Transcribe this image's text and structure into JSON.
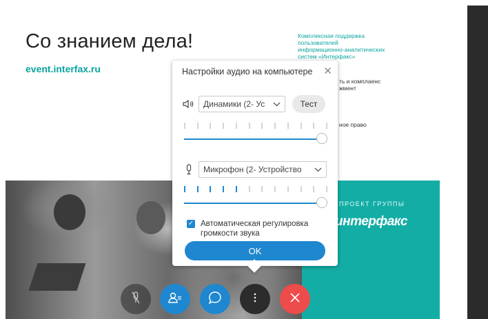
{
  "slide": {
    "title": "Со знанием дела!",
    "url": "event.interfax.ru",
    "info_text": "Комплексная поддержка\nпользователей\nинформационно-аналитических\nсистем «Интерфакс»",
    "bullets": [
      "ть и комплаенс\nжмент",
      "ное право"
    ],
    "teal_caption": "ПРОЕКТ ГРУППЫ",
    "teal_logo": "интерфакс",
    "colors": {
      "teal": "#13ada6",
      "title": "#222222"
    }
  },
  "audio_dialog": {
    "title": "Настройки аудио на компьютере",
    "close_icon": "close-icon",
    "speaker": {
      "icon": "speaker-icon",
      "selected": "Динамики (2- Ус",
      "test_label": "Тест",
      "meter_level": 0,
      "volume": 1.0
    },
    "microphone": {
      "icon": "microphone-icon",
      "selected": "Микрофон (2- Устройство",
      "meter_level": 0.45,
      "volume": 1.0
    },
    "auto_gain": {
      "checked": true,
      "label": "Автоматическая регулировка громкости звука"
    },
    "ok_label": "OK"
  },
  "meeting_controls": [
    {
      "name": "mic-toggle",
      "icon": "microphone-off-icon"
    },
    {
      "name": "participants",
      "icon": "participants-icon"
    },
    {
      "name": "chat",
      "icon": "chat-icon"
    },
    {
      "name": "more-options",
      "icon": "more-vertical-icon"
    },
    {
      "name": "leave-meeting",
      "icon": "close-icon"
    }
  ],
  "colors": {
    "accent": "#1f87cf",
    "end_call": "#ee4b4b"
  }
}
